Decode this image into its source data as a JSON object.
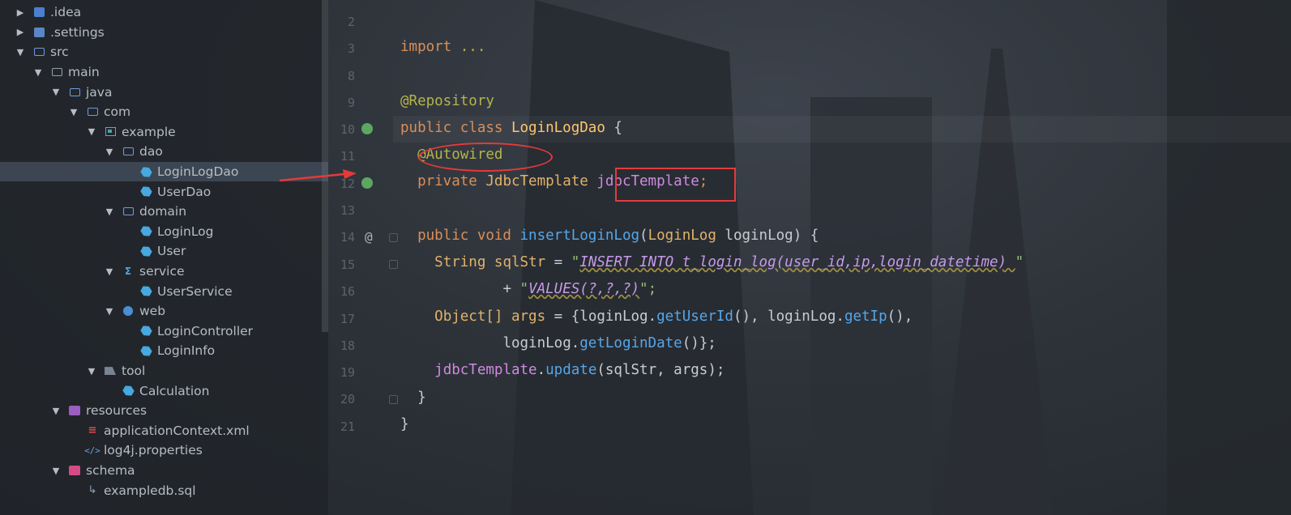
{
  "tree": [
    {
      "label": ".idea",
      "depth": 0,
      "arrow": "collapsed",
      "icon": "idea-folder-icon"
    },
    {
      "label": ".settings",
      "depth": 0,
      "arrow": "collapsed",
      "icon": "settings-folder-icon"
    },
    {
      "label": "src",
      "depth": 0,
      "arrow": "expanded",
      "icon": "source-root-icon"
    },
    {
      "label": "main",
      "depth": 1,
      "arrow": "expanded",
      "icon": "folder-icon"
    },
    {
      "label": "java",
      "depth": 2,
      "arrow": "expanded",
      "icon": "source-folder-icon"
    },
    {
      "label": "com",
      "depth": 3,
      "arrow": "expanded",
      "icon": "package-folder-icon"
    },
    {
      "label": "example",
      "depth": 4,
      "arrow": "expanded",
      "icon": "package-icon"
    },
    {
      "label": "dao",
      "depth": 5,
      "arrow": "expanded",
      "icon": "package-folder-icon"
    },
    {
      "label": "LoginLogDao",
      "depth": 6,
      "arrow": "none",
      "icon": "java-class-icon",
      "selected": true
    },
    {
      "label": "UserDao",
      "depth": 6,
      "arrow": "none",
      "icon": "java-class-icon"
    },
    {
      "label": "domain",
      "depth": 5,
      "arrow": "expanded",
      "icon": "package-folder-icon"
    },
    {
      "label": "LoginLog",
      "depth": 6,
      "arrow": "none",
      "icon": "java-class-icon"
    },
    {
      "label": "User",
      "depth": 6,
      "arrow": "none",
      "icon": "java-class-icon"
    },
    {
      "label": "service",
      "depth": 5,
      "arrow": "expanded",
      "icon": "service-package-icon"
    },
    {
      "label": "UserService",
      "depth": 6,
      "arrow": "none",
      "icon": "java-class-icon"
    },
    {
      "label": "web",
      "depth": 5,
      "arrow": "expanded",
      "icon": "web-package-icon"
    },
    {
      "label": "LoginController",
      "depth": 6,
      "arrow": "none",
      "icon": "java-class-icon"
    },
    {
      "label": "LoginInfo",
      "depth": 6,
      "arrow": "none",
      "icon": "java-class-icon"
    },
    {
      "label": "tool",
      "depth": 4,
      "arrow": "expanded",
      "icon": "tool-package-icon"
    },
    {
      "label": "Calculation",
      "depth": 5,
      "arrow": "none",
      "icon": "java-class-icon"
    },
    {
      "label": "resources",
      "depth": 2,
      "arrow": "expanded",
      "icon": "resources-folder-icon"
    },
    {
      "label": "applicationContext.xml",
      "depth": 3,
      "arrow": "none",
      "icon": "xml-file-icon"
    },
    {
      "label": "log4j.properties",
      "depth": 3,
      "arrow": "none",
      "icon": "properties-file-icon"
    },
    {
      "label": "schema",
      "depth": 2,
      "arrow": "expanded",
      "icon": "schema-folder-icon"
    },
    {
      "label": "exampledb.sql",
      "depth": 3,
      "arrow": "none",
      "icon": "sql-file-icon"
    }
  ],
  "line_numbers": [
    "2",
    "3",
    "8",
    "9",
    "10",
    "11",
    "12",
    "13",
    "14",
    "15",
    "16",
    "17",
    "18",
    "19",
    "20",
    "21"
  ],
  "code": {
    "import_kw": "import",
    "import_rest": " ...",
    "repository": "@Repository",
    "class_kw": "public class ",
    "class_name": "LoginLogDao",
    "class_brace": " {",
    "autowired": "@Autowired",
    "field_kw": "private ",
    "field_type": "JdbcTemplate ",
    "field_name": "jdbcTemplate",
    "field_semicolon": ";",
    "method_kw": "public void ",
    "method_name": "insertLoginLog",
    "method_params_open": "(",
    "param_type": "LoginLog",
    "param_name": " loginLog",
    "method_params_close": ") {",
    "sql_type": "String ",
    "sql_var": "sqlStr",
    "sql_eq": " = ",
    "sql_q1": "\"",
    "sql_text1": "INSERT INTO t_login_log(user_id,ip,login_datetime) ",
    "sql_q1_end": "\"",
    "plus": "+ ",
    "sql_q2": "\"",
    "sql_text2": "VALUES(?,?,?)",
    "sql_q2_end": "\";",
    "obj_type": "Object[] ",
    "args_var": "args",
    "args_eq": " = {",
    "ll1": "loginLog.",
    "getUserId": "getUserId",
    "paren_comma": "(), ",
    "ll2": "loginLog.",
    "getIp": "getIp",
    "paren_comma2": "(),",
    "ll3": "loginLog.",
    "getLoginDate": "getLoginDate",
    "close_args": "()};",
    "jt": "jdbcTemplate",
    "dot": ".",
    "update": "update",
    "update_args": "(sqlStr, args);",
    "close1": "}",
    "close2": "}"
  },
  "colors": {
    "keyword": "#d98f5a",
    "annotation": "#b5b44a",
    "method": "#56a6e8",
    "field": "#d08ae0",
    "highlight": "#e53a3a"
  }
}
